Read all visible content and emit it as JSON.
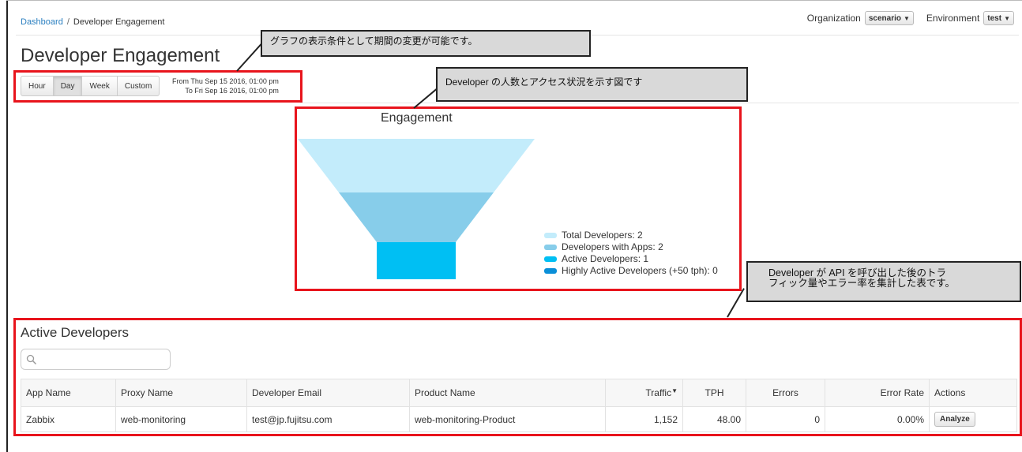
{
  "breadcrumb": {
    "root": "Dashboard",
    "separator": "/",
    "current": "Developer Engagement"
  },
  "header": {
    "organization_label": "Organization",
    "organization_value": "scenario",
    "environment_label": "Environment",
    "environment_value": "test"
  },
  "page": {
    "title": "Developer Engagement"
  },
  "time_range": {
    "buttons": [
      "Hour",
      "Day",
      "Week",
      "Custom"
    ],
    "active": "Day",
    "from_text": "From Thu Sep 15 2016, 01:00 pm",
    "to_text": "To  Fri Sep 16 2016, 01:00 pm"
  },
  "callouts": {
    "period": "グラフの表示条件として期間の変更が可能です。",
    "chart": "Developer の人数とアクセス状況を示す図です",
    "table_line1": "Developer が API を呼び出した後のトラ",
    "table_line2": "フィック量やエラー率を集計した表です。"
  },
  "chart_data": {
    "type": "funnel",
    "title": "Engagement",
    "series": [
      {
        "name": "Total Developers: 2",
        "value": 2,
        "color": "#c3ecfb"
      },
      {
        "name": "Developers with Apps: 2",
        "value": 2,
        "color": "#87cdea"
      },
      {
        "name": "Active Developers: 1",
        "value": 1,
        "color": "#00bff3"
      },
      {
        "name": "Highly Active Developers (+50 tph): 0",
        "value": 0,
        "color": "#0a8fd8"
      }
    ]
  },
  "active_developers": {
    "title": "Active Developers",
    "search_placeholder": "",
    "columns": [
      "App Name",
      "Proxy Name",
      "Developer Email",
      "Product Name",
      "Traffic",
      "TPH",
      "Errors",
      "Error Rate",
      "Actions"
    ],
    "rows": [
      {
        "app": "Zabbix",
        "proxy": "web-monitoring",
        "email": "test@jp.fujitsu.com",
        "product": "web-monitoring-Product",
        "traffic": "1,152",
        "tph": "48.00",
        "errors": "0",
        "error_rate": "0.00%",
        "action": "Analyze"
      }
    ]
  },
  "colors": {
    "highlight": "#e8141c",
    "link": "#2a7fc0",
    "callout_bg": "#d9d9d9"
  }
}
